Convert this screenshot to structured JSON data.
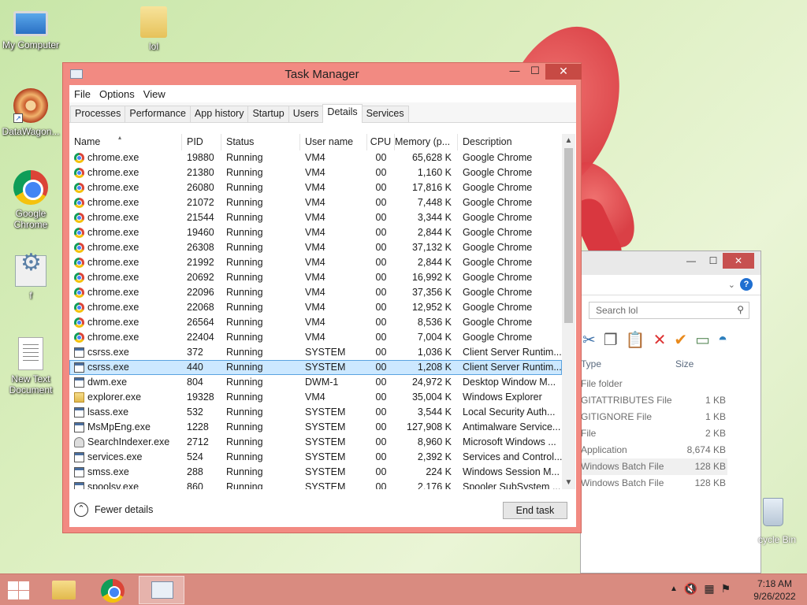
{
  "desktop": {
    "icons": [
      {
        "label": "My Computer"
      },
      {
        "label": "lol"
      },
      {
        "label": "DataWagon..."
      },
      {
        "label": "Google Chrome"
      },
      {
        "label": "f"
      },
      {
        "label": "New Text Document"
      }
    ],
    "recycle_bin_label": "cycle Bin"
  },
  "explorer": {
    "search_placeholder": "Search lol",
    "col_type": "Type",
    "col_size": "Size",
    "rows": [
      {
        "type": "File folder",
        "size": ""
      },
      {
        "type": "GITATTRIBUTES File",
        "size": "1 KB"
      },
      {
        "type": "GITIGNORE File",
        "size": "1 KB"
      },
      {
        "type": "File",
        "size": "2 KB"
      },
      {
        "type": "Application",
        "size": "8,674 KB"
      },
      {
        "type": "Windows Batch File",
        "size": "128 KB"
      },
      {
        "type": "Windows Batch File",
        "size": "128 KB"
      }
    ]
  },
  "task_manager": {
    "title": "Task Manager",
    "menu": [
      "File",
      "Options",
      "View"
    ],
    "tabs": [
      "Processes",
      "Performance",
      "App history",
      "Startup",
      "Users",
      "Details",
      "Services"
    ],
    "active_tab": "Details",
    "columns": [
      "Name",
      "PID",
      "Status",
      "User name",
      "CPU",
      "Memory (p...",
      "Description"
    ],
    "rows": [
      {
        "icon": "chrome",
        "name": "chrome.exe",
        "pid": "19880",
        "status": "Running",
        "user": "VM4",
        "cpu": "00",
        "mem": "65,628 K",
        "desc": "Google Chrome"
      },
      {
        "icon": "chrome",
        "name": "chrome.exe",
        "pid": "21380",
        "status": "Running",
        "user": "VM4",
        "cpu": "00",
        "mem": "1,160 K",
        "desc": "Google Chrome"
      },
      {
        "icon": "chrome",
        "name": "chrome.exe",
        "pid": "26080",
        "status": "Running",
        "user": "VM4",
        "cpu": "00",
        "mem": "17,816 K",
        "desc": "Google Chrome"
      },
      {
        "icon": "chrome",
        "name": "chrome.exe",
        "pid": "21072",
        "status": "Running",
        "user": "VM4",
        "cpu": "00",
        "mem": "7,448 K",
        "desc": "Google Chrome"
      },
      {
        "icon": "chrome",
        "name": "chrome.exe",
        "pid": "21544",
        "status": "Running",
        "user": "VM4",
        "cpu": "00",
        "mem": "3,344 K",
        "desc": "Google Chrome"
      },
      {
        "icon": "chrome",
        "name": "chrome.exe",
        "pid": "19460",
        "status": "Running",
        "user": "VM4",
        "cpu": "00",
        "mem": "2,844 K",
        "desc": "Google Chrome"
      },
      {
        "icon": "chrome",
        "name": "chrome.exe",
        "pid": "26308",
        "status": "Running",
        "user": "VM4",
        "cpu": "00",
        "mem": "37,132 K",
        "desc": "Google Chrome"
      },
      {
        "icon": "chrome",
        "name": "chrome.exe",
        "pid": "21992",
        "status": "Running",
        "user": "VM4",
        "cpu": "00",
        "mem": "2,844 K",
        "desc": "Google Chrome"
      },
      {
        "icon": "chrome",
        "name": "chrome.exe",
        "pid": "20692",
        "status": "Running",
        "user": "VM4",
        "cpu": "00",
        "mem": "16,992 K",
        "desc": "Google Chrome"
      },
      {
        "icon": "chrome",
        "name": "chrome.exe",
        "pid": "22096",
        "status": "Running",
        "user": "VM4",
        "cpu": "00",
        "mem": "37,356 K",
        "desc": "Google Chrome"
      },
      {
        "icon": "chrome",
        "name": "chrome.exe",
        "pid": "22068",
        "status": "Running",
        "user": "VM4",
        "cpu": "00",
        "mem": "12,952 K",
        "desc": "Google Chrome"
      },
      {
        "icon": "chrome",
        "name": "chrome.exe",
        "pid": "26564",
        "status": "Running",
        "user": "VM4",
        "cpu": "00",
        "mem": "8,536 K",
        "desc": "Google Chrome"
      },
      {
        "icon": "chrome",
        "name": "chrome.exe",
        "pid": "22404",
        "status": "Running",
        "user": "VM4",
        "cpu": "00",
        "mem": "7,004 K",
        "desc": "Google Chrome"
      },
      {
        "icon": "window",
        "name": "csrss.exe",
        "pid": "372",
        "status": "Running",
        "user": "SYSTEM",
        "cpu": "00",
        "mem": "1,036 K",
        "desc": "Client Server Runtim..."
      },
      {
        "icon": "window",
        "name": "csrss.exe",
        "pid": "440",
        "status": "Running",
        "user": "SYSTEM",
        "cpu": "00",
        "mem": "1,208 K",
        "desc": "Client Server Runtim...",
        "selected": true
      },
      {
        "icon": "window",
        "name": "dwm.exe",
        "pid": "804",
        "status": "Running",
        "user": "DWM-1",
        "cpu": "00",
        "mem": "24,972 K",
        "desc": "Desktop Window M..."
      },
      {
        "icon": "folder",
        "name": "explorer.exe",
        "pid": "19328",
        "status": "Running",
        "user": "VM4",
        "cpu": "00",
        "mem": "35,004 K",
        "desc": "Windows Explorer"
      },
      {
        "icon": "window",
        "name": "lsass.exe",
        "pid": "532",
        "status": "Running",
        "user": "SYSTEM",
        "cpu": "00",
        "mem": "3,544 K",
        "desc": "Local Security Auth..."
      },
      {
        "icon": "window",
        "name": "MsMpEng.exe",
        "pid": "1228",
        "status": "Running",
        "user": "SYSTEM",
        "cpu": "00",
        "mem": "127,908 K",
        "desc": "Antimalware Service..."
      },
      {
        "icon": "search",
        "name": "SearchIndexer.exe",
        "pid": "2712",
        "status": "Running",
        "user": "SYSTEM",
        "cpu": "00",
        "mem": "8,960 K",
        "desc": "Microsoft Windows ..."
      },
      {
        "icon": "window",
        "name": "services.exe",
        "pid": "524",
        "status": "Running",
        "user": "SYSTEM",
        "cpu": "00",
        "mem": "2,392 K",
        "desc": "Services and Control..."
      },
      {
        "icon": "window",
        "name": "smss.exe",
        "pid": "288",
        "status": "Running",
        "user": "SYSTEM",
        "cpu": "00",
        "mem": "224 K",
        "desc": "Windows Session M..."
      },
      {
        "icon": "window",
        "name": "spoolsv.exe",
        "pid": "860",
        "status": "Running",
        "user": "SYSTEM",
        "cpu": "00",
        "mem": "2,176 K",
        "desc": "Spooler SubSystem ..."
      }
    ],
    "fewer_details": "Fewer details",
    "end_task": "End task"
  },
  "taskbar": {
    "time": "7:18 AM",
    "date": "9/26/2022"
  }
}
